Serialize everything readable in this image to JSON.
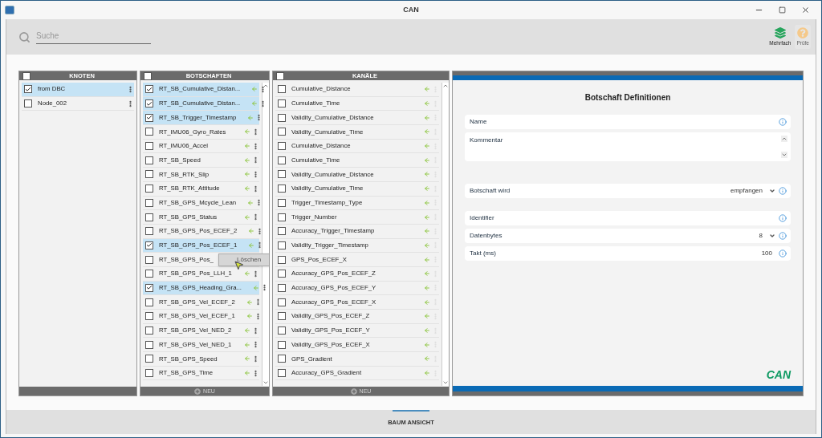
{
  "window": {
    "title": "CAN"
  },
  "toolbar": {
    "search": {
      "placeholder": "Suche"
    },
    "buttons": [
      {
        "kind": "multi",
        "label": "Mehrfach",
        "disabled": false
      },
      {
        "kind": "check",
        "label": "Prüfe",
        "disabled": true
      }
    ]
  },
  "nodes": {
    "header": "KNOTEN",
    "all_checked": false,
    "items": [
      {
        "label": "from DBC",
        "checked": true
      },
      {
        "label": "Node_002",
        "checked": false
      }
    ]
  },
  "messages": {
    "header": "BOTSCHAFTEN",
    "all_checked": false,
    "footer": "NEU",
    "footer_disabled": true,
    "items": [
      {
        "label": "RT_SB_Cumulative_Distan...",
        "checked": true
      },
      {
        "label": "RT_SB_Cumulative_Distan...",
        "checked": true
      },
      {
        "label": "RT_SB_Trigger_Timestamp",
        "checked": true
      },
      {
        "label": "RT_IMU06_Gyro_Rates",
        "checked": false
      },
      {
        "label": "RT_IMU06_Accel",
        "checked": false
      },
      {
        "label": "RT_SB_Speed",
        "checked": false
      },
      {
        "label": "RT_SB_RTK_Slip",
        "checked": false
      },
      {
        "label": "RT_SB_RTK_Attitude",
        "checked": false
      },
      {
        "label": "RT_SB_GPS_Mcycle_Lean",
        "checked": false
      },
      {
        "label": "RT_SB_GPS_Status",
        "checked": false
      },
      {
        "label": "RT_SB_GPS_Pos_ECEF_2",
        "checked": false
      },
      {
        "label": "RT_SB_GPS_Pos_ECEF_1",
        "checked": true
      },
      {
        "label": "RT_SB_GPS_Pos_",
        "checked": false
      },
      {
        "label": "RT_SB_GPS_Pos_LLH_1",
        "checked": false
      },
      {
        "label": "RT_SB_GPS_Heading_Gra...",
        "checked": true
      },
      {
        "label": "RT_SB_GPS_Vel_ECEF_2",
        "checked": false
      },
      {
        "label": "RT_SB_GPS_Vel_ECEF_1",
        "checked": false
      },
      {
        "label": "RT_SB_GPS_Vel_NED_2",
        "checked": false
      },
      {
        "label": "RT_SB_GPS_Vel_NED_1",
        "checked": false
      },
      {
        "label": "RT_SB_GPS_Speed",
        "checked": false
      },
      {
        "label": "RT_SB_GPS_Time",
        "checked": false
      }
    ]
  },
  "context_menu": {
    "items": [
      "Löschen"
    ]
  },
  "channels": {
    "header": "KANÄLE",
    "all_checked": false,
    "footer": "NEU",
    "footer_disabled": true,
    "items": [
      {
        "label": "Cumulative_Distance",
        "checked": false
      },
      {
        "label": "Cumulative_Time",
        "checked": false
      },
      {
        "label": "Validity_Cumulative_Distance",
        "checked": false
      },
      {
        "label": "Validity_Cumulative_Time",
        "checked": false
      },
      {
        "label": "Cumulative_Distance",
        "checked": false
      },
      {
        "label": "Cumulative_Time",
        "checked": false
      },
      {
        "label": "Validity_Cumulative_Distance",
        "checked": false
      },
      {
        "label": "Validity_Cumulative_Time",
        "checked": false
      },
      {
        "label": "Trigger_Timestamp_Type",
        "checked": false
      },
      {
        "label": "Trigger_Number",
        "checked": false
      },
      {
        "label": "Accuracy_Trigger_Timestamp",
        "checked": false
      },
      {
        "label": "Validity_Trigger_Timestamp",
        "checked": false
      },
      {
        "label": "GPS_Pos_ECEF_X",
        "checked": false
      },
      {
        "label": "Accuracy_GPS_Pos_ECEF_Z",
        "checked": false
      },
      {
        "label": "Accuracy_GPS_Pos_ECEF_Y",
        "checked": false
      },
      {
        "label": "Accuracy_GPS_Pos_ECEF_X",
        "checked": false
      },
      {
        "label": "Validity_GPS_Pos_ECEF_Z",
        "checked": false
      },
      {
        "label": "Validity_GPS_Pos_ECEF_Y",
        "checked": false
      },
      {
        "label": "Validity_GPS_Pos_ECEF_X",
        "checked": false
      },
      {
        "label": "GPS_Gradient",
        "checked": false
      },
      {
        "label": "Accuracy_GPS_Gradient",
        "checked": false
      }
    ]
  },
  "definition": {
    "title": "Botschaft Definitionen",
    "groups": [
      [
        {
          "kind": "text",
          "label": "Name"
        },
        {
          "kind": "textarea",
          "label": "Kommentar"
        }
      ],
      [
        {
          "kind": "select",
          "label": "Botschaft wird",
          "value": "empfangen"
        }
      ],
      [
        {
          "kind": "text",
          "label": "Identifier"
        },
        {
          "kind": "select",
          "label": "Datenbytes",
          "value": "8"
        },
        {
          "kind": "text",
          "label": "Takt (ms)",
          "value": "100"
        }
      ]
    ],
    "logo": "CAN"
  },
  "bottom_tabs": [
    {
      "label": "BAUM ANSICHT",
      "selected": true
    }
  ]
}
